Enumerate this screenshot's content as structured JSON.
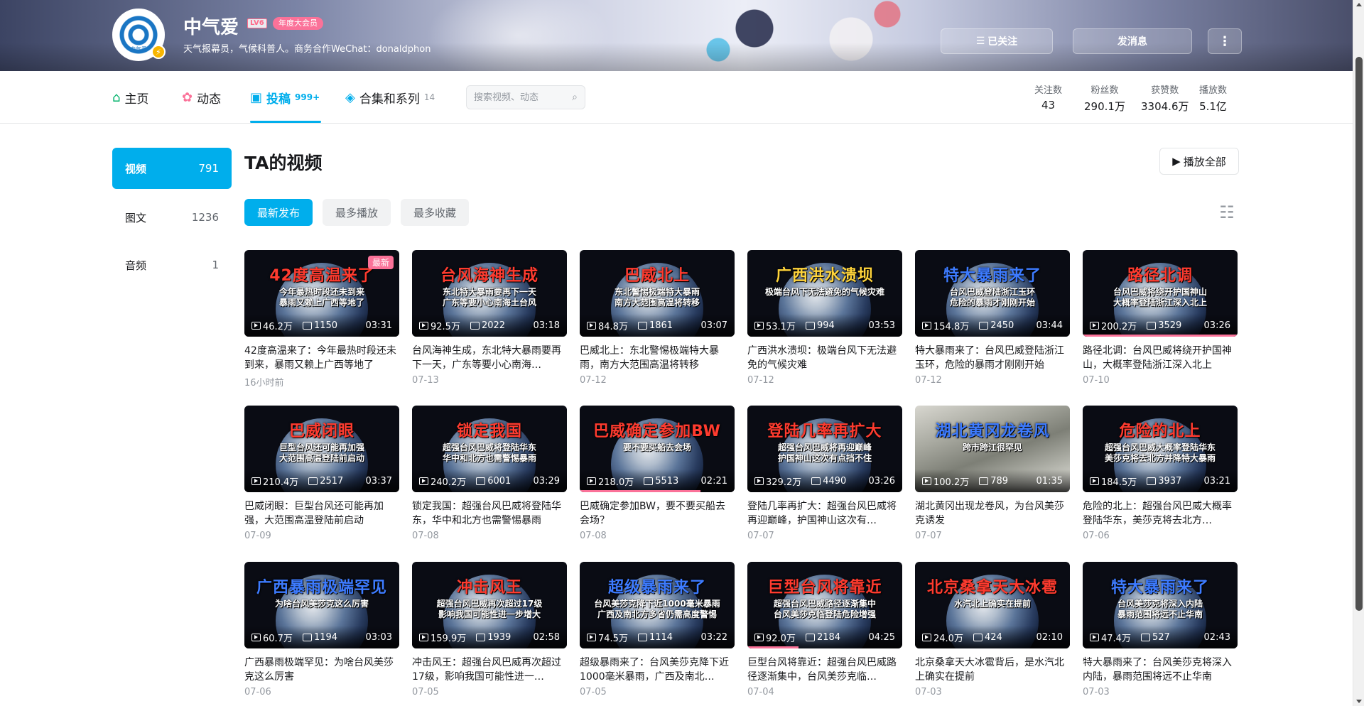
{
  "header": {
    "username": "中气爱",
    "level": "LV6",
    "vip_label": "年度大会员",
    "signature": "天气报幕员，气候科普人。商务合作WeChat：donaldphon",
    "avatar_text": "中气爱",
    "follow_label": "已关注",
    "message_label": "发消息",
    "more_label": "⋮"
  },
  "nav": {
    "tabs": [
      {
        "label": "主页",
        "icon": "home-icon",
        "count": ""
      },
      {
        "label": "动态",
        "icon": "dynamic-icon",
        "count": ""
      },
      {
        "label": "投稿",
        "icon": "upload-icon",
        "count": "999+"
      },
      {
        "label": "合集和系列",
        "icon": "collection-icon",
        "count": "14"
      }
    ],
    "search_placeholder": "搜索视频、动态",
    "stats": [
      {
        "label": "关注数",
        "value": "43"
      },
      {
        "label": "粉丝数",
        "value": "290.1万"
      },
      {
        "label": "获赞数",
        "value": "3304.6万"
      },
      {
        "label": "播放数",
        "value": "5.1亿"
      }
    ]
  },
  "sidebar": {
    "items": [
      {
        "label": "视频",
        "count": "791"
      },
      {
        "label": "图文",
        "count": "1236"
      },
      {
        "label": "音频",
        "count": "1"
      }
    ]
  },
  "main": {
    "title": "TA的视频",
    "play_all": "播放全部",
    "sort": [
      "最新发布",
      "最多播放",
      "最多收藏"
    ],
    "videos": [
      {
        "thumb_title": "42度高温来了",
        "thumb_sub": "今年最热时段还未到来\n暴雨又赖上广西等地了",
        "color": "red",
        "views": "46.2万",
        "danmaku": "1150",
        "duration": "03:31",
        "title": "42度高温来了：今年最热时段还未到来，暴雨又赖上广西等地了",
        "date": "16小时前",
        "new_tag": "最新"
      },
      {
        "thumb_title": "台风海神生成",
        "thumb_sub": "东北特大暴雨要再下一天\n广东等要小心南海土台风",
        "color": "red",
        "views": "92.5万",
        "danmaku": "2022",
        "duration": "03:18",
        "title": "台风海神生成，东北特大暴雨要再下一天，广东等要小心南海…",
        "date": "07-13"
      },
      {
        "thumb_title": "巴威北上",
        "thumb_sub": "东北警惕极端特大暴雨\n南方大范围高温将转移",
        "color": "red",
        "views": "84.8万",
        "danmaku": "1861",
        "duration": "03:07",
        "title": "巴威北上：东北警惕极端特大暴雨，南方大范围高温将转移",
        "date": "07-12"
      },
      {
        "thumb_title": "广西洪水溃坝",
        "thumb_sub": "极端台风下无法避免的气候灾难",
        "color": "gold",
        "views": "53.1万",
        "danmaku": "994",
        "duration": "03:53",
        "title": "广西洪水溃坝：极端台风下无法避免的气候灾难",
        "date": "07-12"
      },
      {
        "thumb_title": "特大暴雨来了",
        "thumb_sub": "台风巴威登陆浙江玉环\n危险的暴雨才刚刚开始",
        "color": "blue",
        "views": "154.8万",
        "danmaku": "2450",
        "duration": "03:44",
        "title": "特大暴雨来了：台风巴威登陆浙江玉环，危险的暴雨才刚刚开始",
        "date": "07-12"
      },
      {
        "thumb_title": "路径北调",
        "thumb_sub": "台风巴威将绕开护国神山\n大概率登陆浙江深入北上",
        "color": "red",
        "views": "200.2万",
        "danmaku": "3529",
        "duration": "03:26",
        "title": "路径北调：台风巴威将绕开护国神山，大概率登陆浙江深入北上",
        "date": "07-10",
        "progress": 1.0
      },
      {
        "thumb_title": "巴威闭眼",
        "thumb_sub": "巨型台风还可能再加强\n大范围高温登陆前启动",
        "color": "red",
        "views": "210.4万",
        "danmaku": "2517",
        "duration": "03:37",
        "title": "巴威闭眼：巨型台风还可能再加强，大范围高温登陆前启动",
        "date": "07-09"
      },
      {
        "thumb_title": "锁定我国",
        "thumb_sub": "超强台风巴威将登陆华东\n华中和北方也需警惕暴雨",
        "color": "red",
        "views": "240.2万",
        "danmaku": "6001",
        "duration": "03:29",
        "title": "锁定我国：超强台风巴威将登陆华东，华中和北方也需警惕暴雨",
        "date": "07-08"
      },
      {
        "thumb_title": "巴威确定参加BW",
        "thumb_sub": "要不要买船去会场",
        "color": "red",
        "views": "218.0万",
        "danmaku": "5513",
        "duration": "02:21",
        "title": "巴威确定参加BW，要不要买船去会场？",
        "date": "07-08",
        "progress": 0.78
      },
      {
        "thumb_title": "登陆几率再扩大",
        "thumb_sub": "超强台风巴威将再迎巅峰\n护国神山这次有点挡不住",
        "color": "red",
        "views": "329.2万",
        "danmaku": "4490",
        "duration": "03:26",
        "title": "登陆几率再扩大：超强台风巴威将再迎巅峰，护国神山这次有…",
        "date": "07-07"
      },
      {
        "thumb_title": "湖北黄冈龙卷风",
        "thumb_sub": "跨市跨江很罕见",
        "color": "blue",
        "views": "100.2万",
        "danmaku": "789",
        "duration": "01:35",
        "title": "湖北黄冈出现龙卷风，为台风美莎克诱发",
        "date": "07-07",
        "sat": true
      },
      {
        "thumb_title": "危险的北上",
        "thumb_sub": "超强台风巴威大概率登陆华东\n美莎克将去北方并降特大暴雨",
        "color": "red",
        "views": "184.5万",
        "danmaku": "3937",
        "duration": "03:21",
        "title": "危险的北上：超强台风巴威大概率登陆华东，美莎克将去北方…",
        "date": "07-06"
      },
      {
        "thumb_title": "广西暴雨极端罕见",
        "thumb_sub": "为啥台风美莎克这么厉害",
        "color": "blue",
        "views": "60.7万",
        "danmaku": "1194",
        "duration": "03:03",
        "title": "广西暴雨极端罕见：为啥台风美莎克这么厉害",
        "date": "07-06"
      },
      {
        "thumb_title": "冲击风王",
        "thumb_sub": "超强台风巴威再次超过17级\n影响我国可能性进一步增大",
        "color": "red",
        "views": "159.9万",
        "danmaku": "1939",
        "duration": "02:58",
        "title": "冲击风王：超强台风巴威再次超过17级，影响我国可能性进一…",
        "date": "07-05"
      },
      {
        "thumb_title": "超级暴雨来了",
        "thumb_sub": "台风美莎克降下近1000毫米暴雨\n广西及南北方多省仍需高度警惕",
        "color": "blue",
        "views": "74.5万",
        "danmaku": "1114",
        "duration": "03:22",
        "title": "超级暴雨来了：台风美莎克降下近1000毫米暴雨，广西及南北…",
        "date": "07-05"
      },
      {
        "thumb_title": "巨型台风将靠近",
        "thumb_sub": "超强台风巴威路径逐渐集中\n台风美莎克临登陆危险增强",
        "color": "red",
        "views": "92.0万",
        "danmaku": "2184",
        "duration": "04:25",
        "title": "巨型台风将靠近：超强台风巴威路径逐渐集中，台风美莎克临…",
        "date": "07-04",
        "progress": 0.33
      },
      {
        "thumb_title": "北京桑拿天大冰雹",
        "thumb_sub": "水汽北上确实在提前",
        "color": "red",
        "views": "24.0万",
        "danmaku": "424",
        "duration": "02:10",
        "title": "北京桑拿天大冰雹背后，是水汽北上确实在提前",
        "date": "07-03"
      },
      {
        "thumb_title": "特大暴雨来了",
        "thumb_sub": "台风美莎克将深入内陆\n暴雨范围将远不止华南",
        "color": "blue",
        "views": "47.4万",
        "danmaku": "527",
        "duration": "02:43",
        "title": "特大暴雨来了：台风美莎克将深入内陆，暴雨范围将远不止华南",
        "date": "07-03"
      }
    ]
  }
}
